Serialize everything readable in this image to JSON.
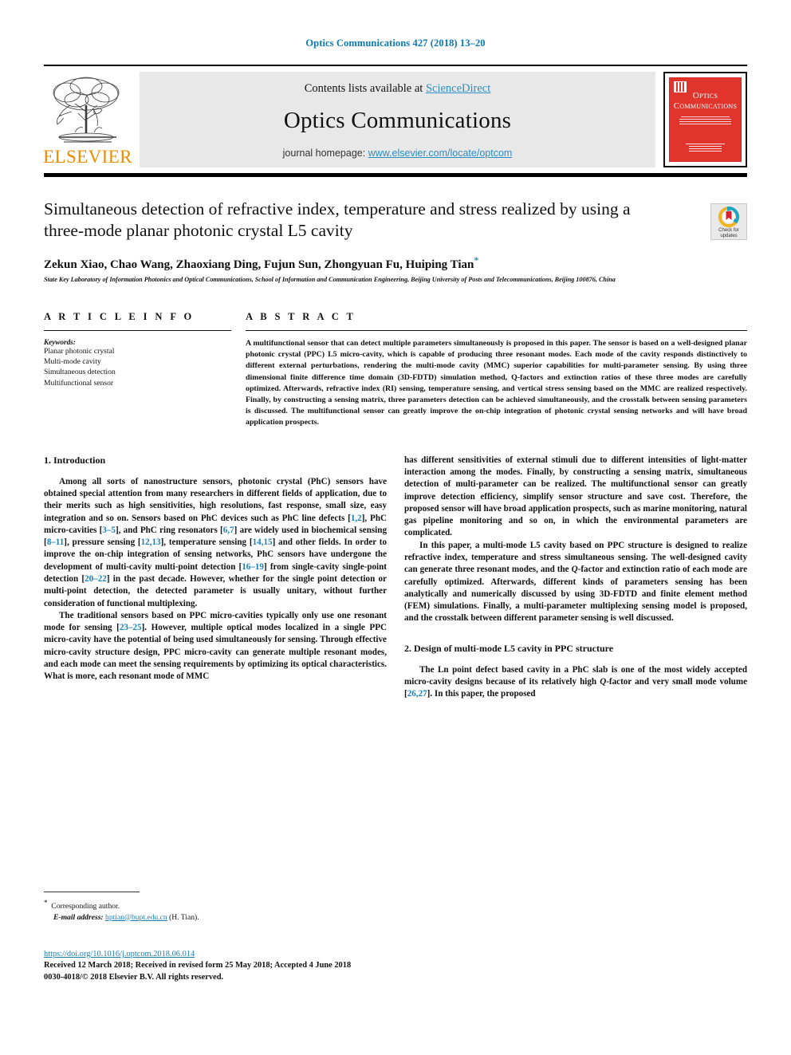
{
  "running_head": "Optics Communications 427 (2018) 13–20",
  "banner": {
    "contents_prefix": "Contents lists available at ",
    "contents_link": "ScienceDirect",
    "journal_name": "Optics Communications",
    "homepage_prefix": "journal homepage: ",
    "homepage_link": "www.elsevier.com/locate/optcom",
    "publisher": "ELSEVIER",
    "cover_title_line1": "Optics",
    "cover_title_line2": "Communications"
  },
  "article": {
    "title": "Simultaneous detection of refractive index, temperature and stress realized by using a three-mode planar photonic crystal L5 cavity",
    "authors": "Zekun Xiao, Chao Wang, Zhaoxiang Ding, Fujun Sun, Zhongyuan Fu, Huiping Tian",
    "corresponding_marker": "*",
    "affiliation": "State Key Laboratory of Information Photonics and Optical Communications, School of Information and Communication Engineering, Beijing University of Posts and Telecommunications, Beijing 100876, China",
    "crossmark_label_line1": "Check for",
    "crossmark_label_line2": "updates"
  },
  "info": {
    "heading": "A R T I C L E   I N F O",
    "keywords_label": "Keywords:",
    "keywords": [
      "Planar photonic crystal",
      "Multi-mode cavity",
      "Simultaneous detection",
      "Multifunctional sensor"
    ]
  },
  "abstract": {
    "heading": "A B S T R A C T",
    "text": "A multifunctional sensor that can detect multiple parameters simultaneously is proposed in this paper. The sensor is based on a well-designed planar photonic crystal (PPC) L5 micro-cavity, which is capable of producing three resonant modes. Each mode of the cavity responds distinctively to different external perturbations, rendering the multi-mode cavity (MMC) superior capabilities for multi-parameter sensing. By using three dimensional finite difference time domain (3D-FDTD) simulation method, Q-factors and extinction ratios of these three modes are carefully optimized. Afterwards, refractive index (RI) sensing, temperature sensing, and vertical stress sensing based on the MMC are realized respectively. Finally, by constructing a sensing matrix, three parameters detection can be achieved simultaneously, and the crosstalk between sensing parameters is discussed. The multifunctional sensor can greatly improve the on-chip integration of photonic crystal sensing networks and will have broad application prospects."
  },
  "sections": {
    "intro_heading": "1.  Introduction",
    "design_heading": "2.  Design of multi-mode L5 cavity in PPC structure"
  },
  "paragraphs": {
    "left_p1_a": "Among all sorts of nanostructure sensors, photonic crystal (PhC) sensors have obtained special attention from many researchers in different fields of application, due to their merits such as high sensitivities, high resolutions, fast response, small size, easy integration and so on. Sensors based on PhC devices such as PhC line defects [",
    "left_p1_r1": "1,2",
    "left_p1_b": "], PhC micro-cavities [",
    "left_p1_r2": "3–5",
    "left_p1_c": "], and PhC ring resonators [",
    "left_p1_r3": "6,7",
    "left_p1_d": "] are widely used in biochemical sensing [",
    "left_p1_r4": "8–11",
    "left_p1_e": "], pressure sensing [",
    "left_p1_r5": "12,13",
    "left_p1_f": "], temperature sensing [",
    "left_p1_r6": "14,15",
    "left_p1_g": "] and other fields. In order to improve the on-chip integration of sensing networks, PhC sensors have undergone the development of multi-cavity multi-point detection [",
    "left_p1_r7": "16–19",
    "left_p1_h": "] from single-cavity single-point detection [",
    "left_p1_r8": "20–22",
    "left_p1_i": "] in the past decade. However, whether for the single point detection or multi-point detection, the detected parameter is usually unitary, without further consideration of functional multiplexing.",
    "left_p2_a": "The traditional sensors based on PPC micro-cavities typically only use one resonant mode for sensing [",
    "left_p2_r1": "23–25",
    "left_p2_b": "]. However, multiple optical modes localized in a single PPC micro-cavity have the potential of being used simultaneously for sensing. Through effective micro-cavity structure design, PPC micro-cavity can generate multiple resonant modes, and each mode can meet the sensing requirements by optimizing its optical characteristics. What is more, each resonant mode of MMC",
    "right_p1": "has different sensitivities of external stimuli due to different intensities of light-matter interaction among the modes. Finally, by constructing a sensing matrix, simultaneous detection of multi-parameter can be realized. The multifunctional sensor can greatly improve detection efficiency, simplify sensor structure and save cost. Therefore, the proposed sensor will have broad application prospects, such as marine monitoring, natural gas pipeline monitoring and so on, in which the environmental parameters are complicated.",
    "right_p2_a": "In this paper, a multi-mode L5 cavity based on PPC structure is designed to realize refractive index, temperature and stress simultaneous sensing. The well-designed cavity can generate three resonant modes, and the ",
    "right_p2_q": "Q",
    "right_p2_b": "-factor and extinction ratio of each mode are carefully optimized. Afterwards, different kinds of parameters sensing has been analytically and numerically discussed by using 3D-FDTD and finite element method (FEM) simulations. Finally, a multi-parameter multiplexing sensing model is proposed, and the crosstalk between different parameter sensing is well discussed.",
    "right_p3_a": "The Ln point defect based cavity in a PhC slab is one of the most widely accepted micro-cavity designs because of its relatively high ",
    "right_p3_q": "Q",
    "right_p3_b": "-factor and very small mode volume [",
    "right_p3_r1": "26,27",
    "right_p3_c": "]. In this paper, the proposed"
  },
  "footnotes": {
    "star": "*",
    "corresponding": "Corresponding author.",
    "email_label": "E-mail address:",
    "email": "hptian@bupt.edu.cn",
    "email_owner": "(H. Tian).",
    "doi": "https://doi.org/10.1016/j.optcom.2018.06.014",
    "history": "Received 12 March 2018; Received in revised form 25 May 2018; Accepted 4 June 2018",
    "copyright": "0030-4018/© 2018 Elsevier B.V. All rights reserved."
  },
  "colors": {
    "link": "#2b8fc4",
    "reference": "#1a7fb5",
    "elsevier_orange": "#ED8B00",
    "cover_red": "#E0342C"
  }
}
